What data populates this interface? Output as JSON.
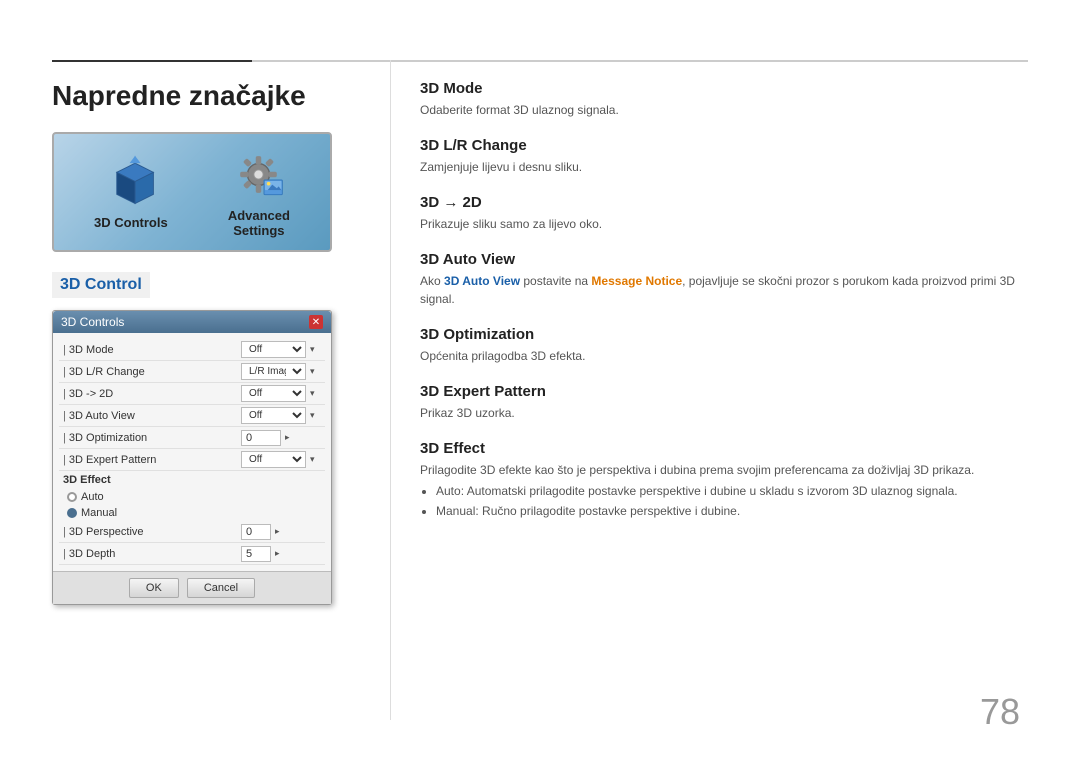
{
  "page": {
    "title": "Napredne značajke",
    "number": "78",
    "top_line_break": 200
  },
  "icon_panel": {
    "items": [
      {
        "label": "3D Controls",
        "icon_type": "cube"
      },
      {
        "label": "Advanced\nSettings",
        "icon_type": "gear"
      }
    ]
  },
  "section_header": "3D Control",
  "dialog": {
    "title": "3D Controls",
    "close_label": "✕",
    "rows": [
      {
        "label": "3D Mode",
        "value": "Off",
        "type": "select"
      },
      {
        "label": "3D L/R Change",
        "value": "L/R Image",
        "type": "select"
      },
      {
        "label": "3D -> 2D",
        "value": "Off",
        "type": "select"
      },
      {
        "label": "3D Auto View",
        "value": "Off",
        "type": "select"
      },
      {
        "label": "3D Optimization",
        "value": "0",
        "type": "arrow"
      },
      {
        "label": "3D Expert Pattern",
        "value": "Off",
        "type": "select"
      }
    ],
    "effect_section": "3D Effect",
    "radio_options": [
      {
        "label": "Auto",
        "selected": false
      },
      {
        "label": "Manual",
        "selected": true
      }
    ],
    "sub_rows": [
      {
        "label": "3D Perspective",
        "value": "0"
      },
      {
        "label": "3D Depth",
        "value": "5"
      }
    ],
    "buttons": [
      "OK",
      "Cancel"
    ]
  },
  "features": [
    {
      "title": "3D Mode",
      "desc": "Odaberite format 3D ulaznog signala.",
      "bullets": []
    },
    {
      "title": "3D L/R Change",
      "desc": "Zamjenjuje lijevu i desnu sliku.",
      "bullets": []
    },
    {
      "title": "3D → 2D",
      "desc": "Prikazuje sliku samo za lijevo oko.",
      "bullets": []
    },
    {
      "title": "3D Auto View",
      "desc_parts": [
        {
          "text": "Ako ",
          "style": "normal"
        },
        {
          "text": "3D Auto View",
          "style": "blue"
        },
        {
          "text": " postavite na ",
          "style": "normal"
        },
        {
          "text": "Message Notice",
          "style": "orange"
        },
        {
          "text": ", pojavljuje se skočni prozor s porukom kada proizvod primi 3D signal.",
          "style": "normal"
        }
      ],
      "bullets": []
    },
    {
      "title": "3D Optimization",
      "desc": "Općenita prilagodba 3D efekta.",
      "bullets": []
    },
    {
      "title": "3D Expert Pattern",
      "desc": "Prikaz 3D uzorka.",
      "bullets": []
    },
    {
      "title": "3D Effect",
      "desc": "Prilagodite 3D efekte kao što je perspektiva i dubina prema svojim preferencama za doživljaj 3D prikaza.",
      "bullets": [
        {
          "text": "Auto",
          "link": true,
          "link_color": "blue",
          "rest": ": Automatski prilagodite postavke perspektive i dubine u skladu s izvorom 3D ulaznog signala."
        },
        {
          "text": "Manual",
          "link": true,
          "link_color": "blue",
          "rest": ": Ručno prilagodite postavke perspektive i dubine."
        }
      ]
    }
  ]
}
